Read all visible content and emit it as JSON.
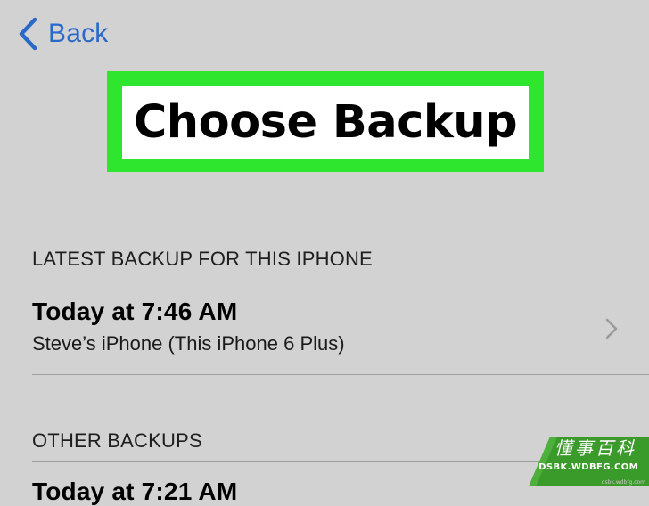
{
  "nav": {
    "back_label": "Back"
  },
  "title": "Choose Backup",
  "latest_section": {
    "header": "LATEST BACKUP FOR THIS IPHONE",
    "item": {
      "title": "Today at 7:46 AM",
      "subtitle": "Steve’s iPhone (This iPhone 6 Plus)"
    }
  },
  "other_section": {
    "header": "OTHER BACKUPS",
    "item": {
      "title": "Today at 7:21 AM"
    }
  },
  "watermark": {
    "chinese": "懂事百科",
    "url": "DSBK.WDBFG.COM",
    "small": "dsbk.wdbfg.com"
  },
  "colors": {
    "accent": "#2a69c8",
    "highlight": "#2fe62f",
    "background": "#d2d2d2",
    "watermark": "#3a9a2a"
  }
}
